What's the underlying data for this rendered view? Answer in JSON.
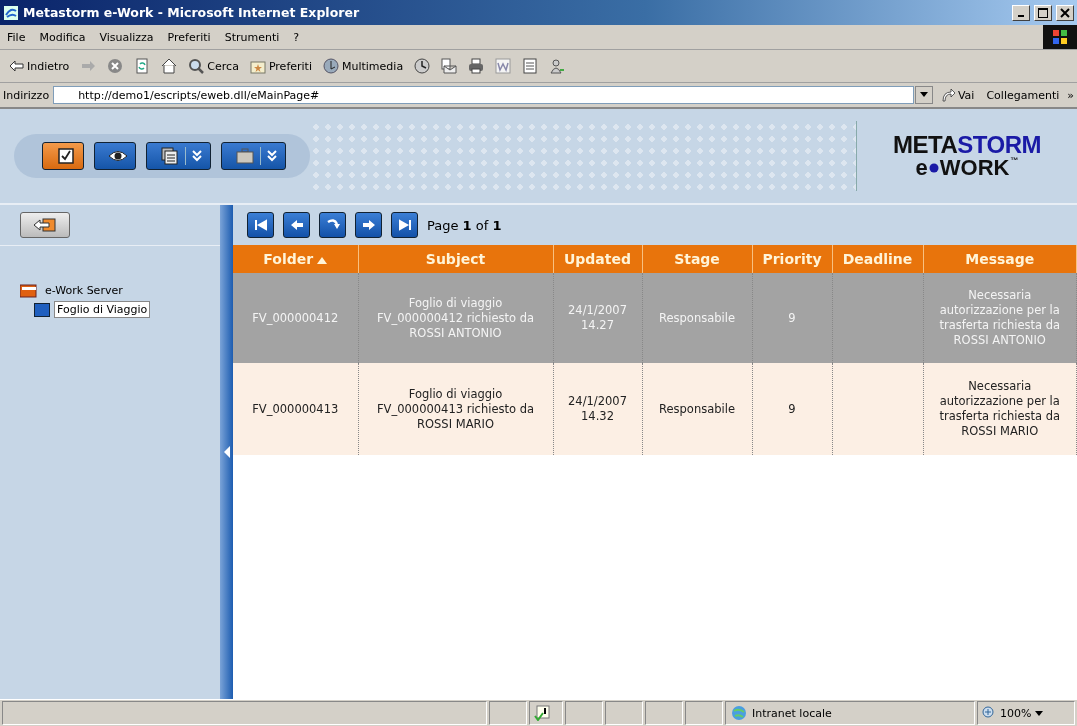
{
  "window": {
    "title": "Metastorm e-Work - Microsoft Internet Explorer"
  },
  "menu": [
    "File",
    "Modifica",
    "Visualizza",
    "Preferiti",
    "Strumenti",
    "?"
  ],
  "toolbar": [
    {
      "kind": "back",
      "label": "Indietro"
    },
    {
      "kind": "forward"
    },
    {
      "kind": "stop"
    },
    {
      "kind": "refresh"
    },
    {
      "kind": "home"
    },
    {
      "kind": "search",
      "label": "Cerca"
    },
    {
      "kind": "favorites",
      "label": "Preferiti"
    },
    {
      "kind": "media",
      "label": "Multimedia"
    },
    {
      "kind": "history"
    },
    {
      "kind": "mail"
    },
    {
      "kind": "print"
    },
    {
      "kind": "edit"
    },
    {
      "kind": "page"
    },
    {
      "kind": "messenger"
    }
  ],
  "address": {
    "label": "Indirizzo",
    "value": "http://demo1/escripts/eweb.dll/eMainPage#",
    "go": "Vai",
    "links": "Collegamenti",
    "more": "»"
  },
  "app_toolbar": [
    {
      "kind": "check",
      "selected": true,
      "dropdown": false
    },
    {
      "kind": "eye",
      "selected": false,
      "dropdown": false
    },
    {
      "kind": "documents",
      "selected": false,
      "dropdown": true
    },
    {
      "kind": "briefcase",
      "selected": false,
      "dropdown": true
    }
  ],
  "logo": {
    "top_dark": "META",
    "top_blue": "STORM",
    "bottom_left": "e",
    "bottom_right": "WORK",
    "mark": "™"
  },
  "tree": [
    {
      "label": "e-Work Server",
      "selected": false,
      "children": [
        {
          "label": "Foglio di Viaggio",
          "selected": true
        }
      ]
    }
  ],
  "pager": {
    "buttons": [
      {
        "kind": "first"
      },
      {
        "kind": "previous"
      },
      {
        "kind": "refresh"
      },
      {
        "kind": "next"
      },
      {
        "kind": "last"
      }
    ],
    "text": "Page **1** of **1**"
  },
  "table": {
    "columns": [
      {
        "label": "Folder",
        "sorted": true
      },
      {
        "label": "Subject"
      },
      {
        "label": "Updated"
      },
      {
        "label": "Stage"
      },
      {
        "label": "Priority"
      },
      {
        "label": "Deadline"
      },
      {
        "label": "Message"
      }
    ],
    "rows": [
      {
        "selected": true,
        "cells": [
          "FV_000000412",
          "Foglio di viaggio FV_000000412 richiesto da ROSSI ANTONIO",
          "24/1/2007 14.27",
          "Responsabile",
          "9",
          "",
          "Necessaria autorizzazione per la trasferta richiesta da ROSSI  ANTONIO"
        ]
      },
      {
        "selected": false,
        "cells": [
          "FV_000000413",
          "Foglio di viaggio FV_000000413 richiesto da ROSSI MARIO",
          "24/1/2007 14.32",
          "Responsabile",
          "9",
          "",
          "Necessaria autorizzazione per la trasferta richiesta da ROSSI  MARIO"
        ]
      }
    ]
  },
  "status_bar": {
    "zone": "Intranet locale",
    "zoom": "100%"
  }
}
